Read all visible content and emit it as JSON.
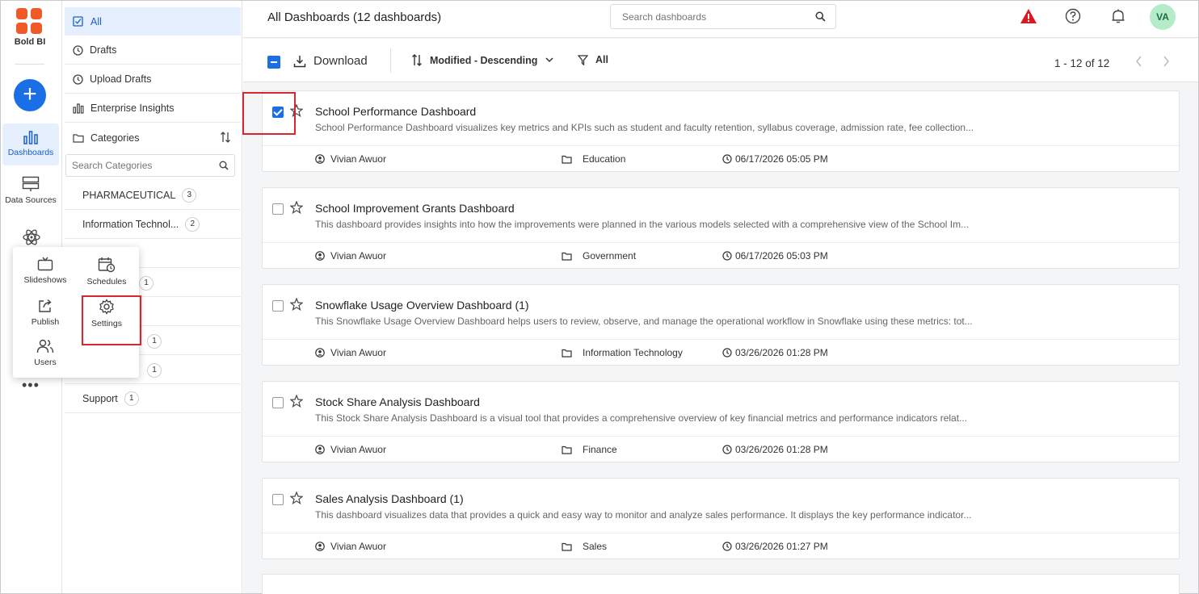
{
  "app": {
    "name": "Bold BI"
  },
  "rail": {
    "add_label": "+",
    "items": [
      {
        "label": "Dashboards",
        "active": true
      },
      {
        "label": "Data Sources",
        "active": false
      }
    ]
  },
  "popup_menu": {
    "items": [
      {
        "label": "Slideshows"
      },
      {
        "label": "Schedules"
      },
      {
        "label": "Publish"
      },
      {
        "label": "Settings"
      },
      {
        "label": "Users"
      }
    ]
  },
  "categories_panel": {
    "nav": [
      {
        "label": "All",
        "active": true
      },
      {
        "label": "Drafts"
      },
      {
        "label": "Upload Drafts"
      },
      {
        "label": "Enterprise Insights"
      },
      {
        "label": "Categories"
      }
    ],
    "search_placeholder": "Search Categories",
    "categories": [
      {
        "name": "PHARMACEUTICAL",
        "count": "3"
      },
      {
        "name": "Information Technol...",
        "count": "2"
      },
      {
        "name": "Support",
        "count": "1"
      }
    ],
    "obscured_counts": [
      "1",
      "1",
      "1"
    ]
  },
  "header": {
    "title": "All Dashboards (12 dashboards)",
    "search_placeholder": "Search dashboards",
    "avatar_initials": "VA",
    "alert_color": "#e0161e"
  },
  "toolbar": {
    "download_label": "Download",
    "sort_label": "Modified - Descending",
    "filter_label": "All",
    "pager_text": "1 - 12 of 12"
  },
  "dashboards": [
    {
      "title": "School Performance Dashboard",
      "description": "School Performance Dashboard visualizes key metrics and KPIs such as student and faculty retention, syllabus coverage, admission rate, fee collection...",
      "owner": "Vivian Awuor",
      "category": "Education",
      "modified": "06/17/2026 05:05 PM",
      "checked": true
    },
    {
      "title": "School Improvement Grants Dashboard",
      "description": "This dashboard provides insights into how the improvements were planned in the various models selected with a comprehensive view of the School Im...",
      "owner": "Vivian Awuor",
      "category": "Government",
      "modified": "06/17/2026 05:03 PM",
      "checked": false
    },
    {
      "title": "Snowflake Usage Overview Dashboard (1)",
      "description": "This Snowflake Usage Overview Dashboard helps users to review, observe, and manage the operational workflow in Snowflake using these metrics: tot...",
      "owner": "Vivian Awuor",
      "category": "Information Technology",
      "modified": "03/26/2026 01:28 PM",
      "checked": false
    },
    {
      "title": "Stock Share Analysis Dashboard",
      "description": "This Stock Share Analysis Dashboard is a visual tool that provides a comprehensive overview of key financial metrics and performance indicators relat...",
      "owner": "Vivian Awuor",
      "category": "Finance",
      "modified": "03/26/2026 01:28 PM",
      "checked": false
    },
    {
      "title": "Sales Analysis Dashboard (1)",
      "description": "This dashboard visualizes data that provides a quick and easy way to monitor and analyze sales performance. It displays the key performance indicator...",
      "owner": "Vivian Awuor",
      "category": "Sales",
      "modified": "03/26/2026 01:27 PM",
      "checked": false
    }
  ],
  "colors": {
    "accent": "#1a6fe6",
    "highlight_box": "#d8262f",
    "logo": "#ef5a28"
  }
}
